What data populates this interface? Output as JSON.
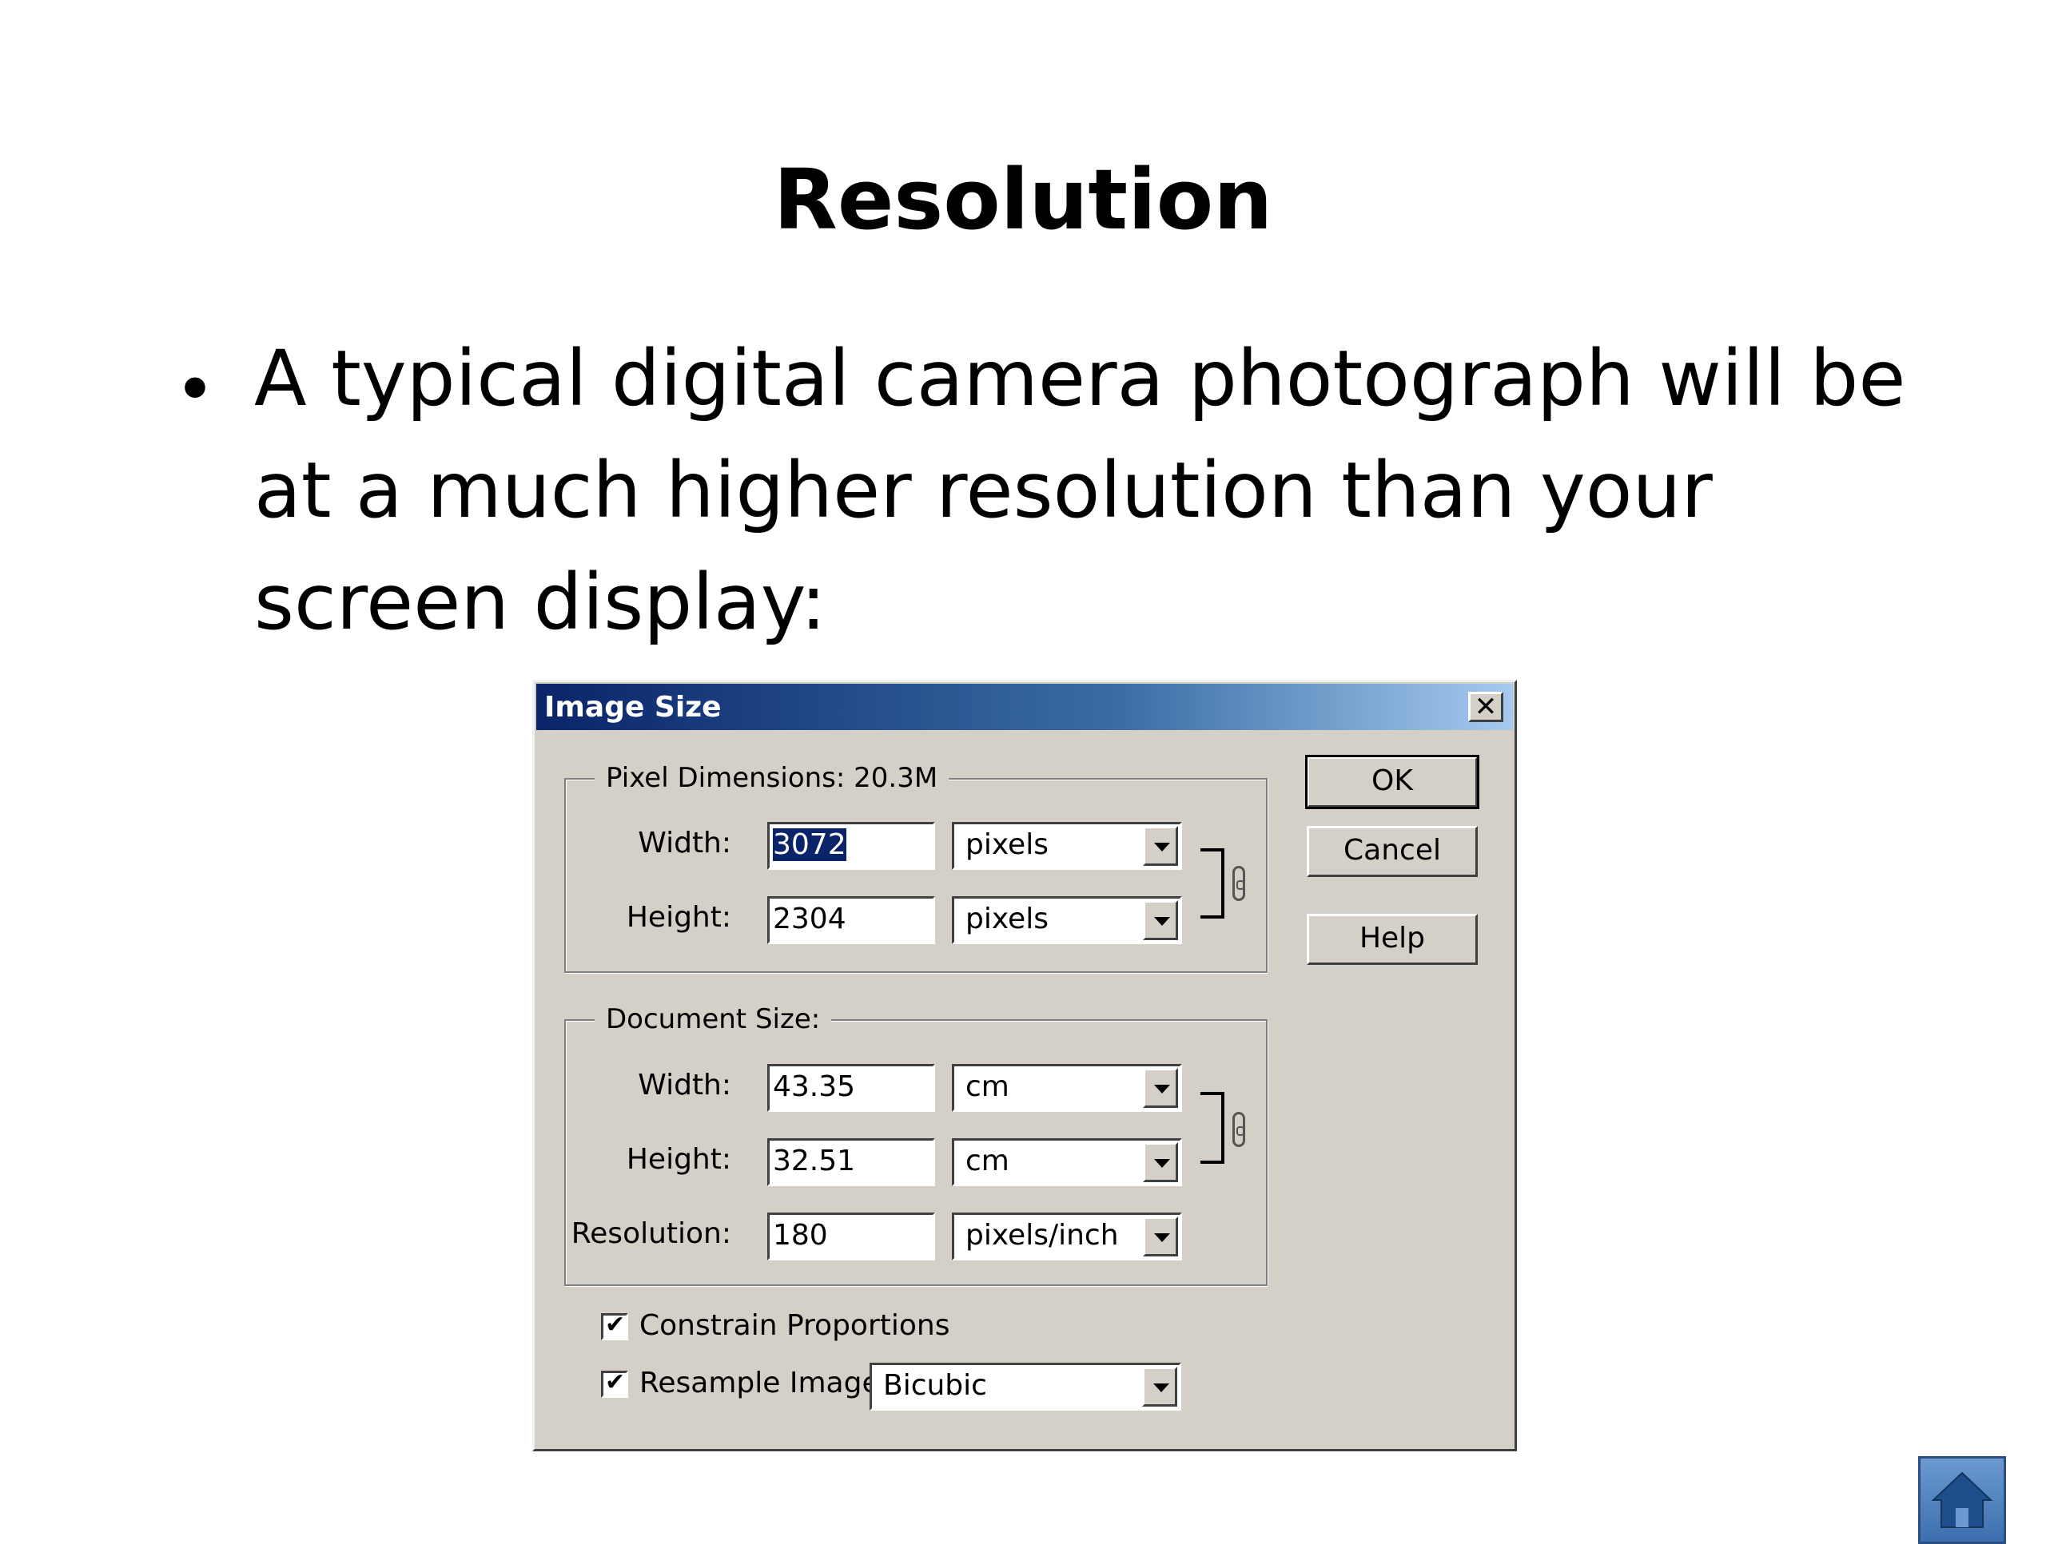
{
  "slide": {
    "title": "Resolution",
    "bullet": "A typical digital camera photograph will be at a much higher resolution than your screen display:"
  },
  "dialog": {
    "title": "Image Size",
    "close_label": "✕",
    "pixel_dimensions": {
      "legend": "Pixel Dimensions:  20.3M",
      "width_label": "Width:",
      "width_value": "3072",
      "width_unit": "pixels",
      "height_label": "Height:",
      "height_value": "2304",
      "height_unit": "pixels"
    },
    "document_size": {
      "legend": "Document Size:",
      "width_label": "Width:",
      "width_value": "43.35",
      "width_unit": "cm",
      "height_label": "Height:",
      "height_value": "32.51",
      "height_unit": "cm",
      "resolution_label": "Resolution:",
      "resolution_value": "180",
      "resolution_unit": "pixels/inch"
    },
    "buttons": {
      "ok": "OK",
      "cancel": "Cancel",
      "help": "Help"
    },
    "constrain_label": "Constrain Proportions",
    "constrain_checked": true,
    "resample_label": "Resample Image:",
    "resample_checked": true,
    "resample_method": "Bicubic"
  },
  "icons": {
    "home": "home-icon",
    "chain": "chain-link-icon"
  }
}
